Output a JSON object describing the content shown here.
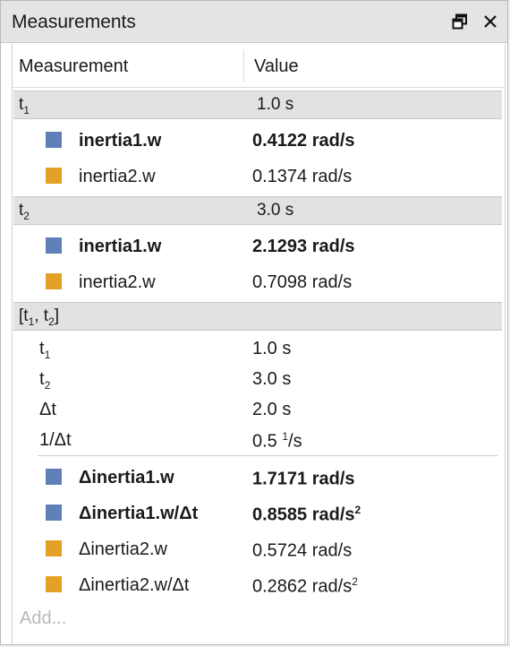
{
  "panel": {
    "title": "Measurements"
  },
  "icons": {
    "float": "float-window-icon",
    "close": "close-icon"
  },
  "colors": {
    "series1": "#5f7fb8",
    "series2": "#e5a126"
  },
  "table": {
    "col_measurement": "Measurement",
    "col_value": "Value"
  },
  "groups": [
    {
      "label_main": "t",
      "label_sub": "1",
      "value": "1.0 s",
      "rows": [
        {
          "name": "inertia1.w",
          "value": "0.4122 rad/s"
        },
        {
          "name": "inertia2.w",
          "value": "0.1374 rad/s"
        }
      ]
    },
    {
      "label_main": "t",
      "label_sub": "2",
      "value": "3.0 s",
      "rows": [
        {
          "name": "inertia1.w",
          "value": "2.1293 rad/s"
        },
        {
          "name": "inertia2.w",
          "value": "0.7098 rad/s"
        }
      ]
    }
  ],
  "interval": {
    "label_open": "[t",
    "sub1": "1",
    "mid": ", t",
    "sub2": "2",
    "label_close": "]",
    "t1_main": "t",
    "t1_sub": "1",
    "t1_value": "1.0 s",
    "t2_main": "t",
    "t2_sub": "2",
    "t2_value": "3.0 s",
    "dt_label": "Δt",
    "dt_value": "2.0 s",
    "inv_label": "1/Δt",
    "inv_value_pre": "0.5 ",
    "inv_value_sup": "1",
    "inv_value_post": "/s",
    "rows": [
      {
        "name": "Δinertia1.w",
        "value": "1.7171 rad/s",
        "value_sup": ""
      },
      {
        "name": "Δinertia1.w/Δt",
        "value": "0.8585 rad/s",
        "value_sup": "2"
      },
      {
        "name": "Δinertia2.w",
        "value": "0.5724 rad/s",
        "value_sup": ""
      },
      {
        "name": "Δinertia2.w/Δt",
        "value": "0.2862 rad/s",
        "value_sup": "2"
      }
    ]
  },
  "add_placeholder": "Add..."
}
